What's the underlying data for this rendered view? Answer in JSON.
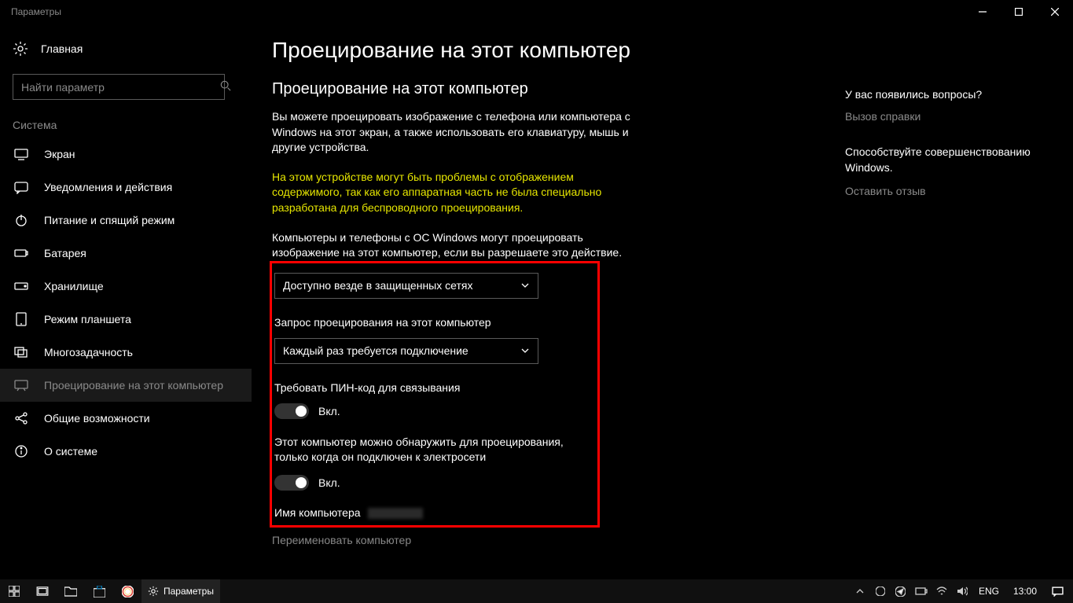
{
  "window": {
    "title": "Параметры"
  },
  "sidebar": {
    "home": "Главная",
    "search_placeholder": "Найти параметр",
    "section": "Система",
    "items": [
      {
        "icon": "display-icon",
        "label": "Экран"
      },
      {
        "icon": "notifications-icon",
        "label": "Уведомления и действия"
      },
      {
        "icon": "power-icon",
        "label": "Питание и спящий режим"
      },
      {
        "icon": "battery-icon",
        "label": "Батарея"
      },
      {
        "icon": "storage-icon",
        "label": "Хранилище"
      },
      {
        "icon": "tablet-icon",
        "label": "Режим планшета"
      },
      {
        "icon": "multitask-icon",
        "label": "Многозадачность"
      },
      {
        "icon": "project-icon",
        "label": "Проецирование на этот компьютер"
      },
      {
        "icon": "shared-icon",
        "label": "Общие возможности"
      },
      {
        "icon": "about-icon",
        "label": "О системе"
      }
    ],
    "active_index": 7
  },
  "content": {
    "h1": "Проецирование на этот компьютер",
    "h2": "Проецирование на этот компьютер",
    "description": "Вы можете проецировать изображение с телефона или компьютера с Windows на этот экран, а также использовать его клавиатуру, мышь и другие устройства.",
    "warning": "На этом устройстве могут быть проблемы с отображением содержимого, так как его аппаратная часть не была специально разработана для беспроводного проецирования.",
    "allow_label": "Компьютеры и телефоны с ОС Windows могут проецировать изображение на этот компьютер, если вы разрешаете это действие.",
    "dropdown1_value": "Доступно везде в защищенных сетях",
    "ask_label": "Запрос проецирования на этот компьютер",
    "dropdown2_value": "Каждый раз требуется подключение",
    "pin_label": "Требовать ПИН-код для связывания",
    "toggle_on": "Вкл.",
    "discover_label": "Этот компьютер можно обнаружить для проецирования, только когда он подключен к электросети",
    "pcname_label": "Имя компьютера",
    "rename": "Переименовать компьютер"
  },
  "rightpanel": {
    "questions_heading": "У вас появились вопросы?",
    "help_link": "Вызов справки",
    "improve_heading": "Способствуйте совершенствованию Windows.",
    "feedback_link": "Оставить отзыв"
  },
  "taskbar": {
    "app_label": "Параметры",
    "lang": "ENG",
    "time": "13:00"
  }
}
